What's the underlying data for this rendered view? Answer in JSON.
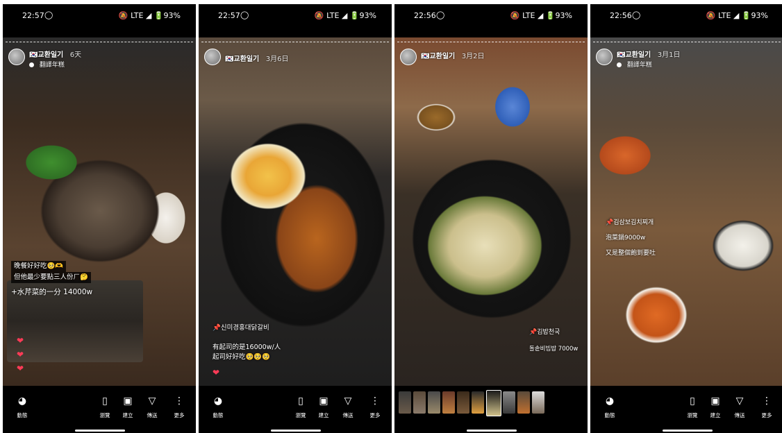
{
  "status": {
    "panels": [
      {
        "time": "22:57",
        "ig_icon": "instagram-icon",
        "right": "🔕 LTE ◢ 🔋93%"
      },
      {
        "time": "22:57",
        "ig_icon": "instagram-icon",
        "right": "🔕 LTE ◢ 🔋93%"
      },
      {
        "time": "22:56",
        "ig_icon": "instagram-icon",
        "right": "🔕 LTE ◢ 🔋93%"
      },
      {
        "time": "22:56",
        "ig_icon": "instagram-icon",
        "right": "🔕 LTE ◢ 🔋93%"
      }
    ]
  },
  "stories": [
    {
      "username": "🇰🇷교환일기",
      "posted": "6天",
      "audio": "翻譯年糕",
      "captions": [
        "晚餐好好吃🥺🫶",
        "但他最少要點三人份ㄏ🤔",
        "+水芹菜的一分 14000w"
      ],
      "hearts": [
        "❤",
        "❤",
        "❤"
      ]
    },
    {
      "username": "🇰🇷교환일기",
      "posted": "3月6日",
      "captions": [
        "📌신미경홍대닭갈비",
        "有起司的是16000w/人",
        "起司好好吃🥺🥺🥺"
      ],
      "hearts": [
        "❤"
      ]
    },
    {
      "username": "🇰🇷교환일기",
      "posted": "3月2日",
      "captions": [
        "📌김밥천국",
        "돌솥비빔밥  7000w"
      ]
    },
    {
      "username": "🇰🇷교환일기",
      "posted": "3月1日",
      "audio": "翻譯年糕",
      "captions": [
        "📌김삼보김치찌개",
        "泡菜鍋9000w",
        "又是整個飽到要吐"
      ]
    }
  ],
  "actions": {
    "activity": "動態",
    "browse": "瀏覽",
    "create": "建立",
    "send": "傳送",
    "more": "更多"
  },
  "icons": {
    "activity": "activity-icon",
    "browse": "browse-icon",
    "create": "create-icon",
    "send": "send-icon",
    "more": "more-icon"
  },
  "colors": {
    "heart": "#ff3b57",
    "background": "#000000"
  }
}
